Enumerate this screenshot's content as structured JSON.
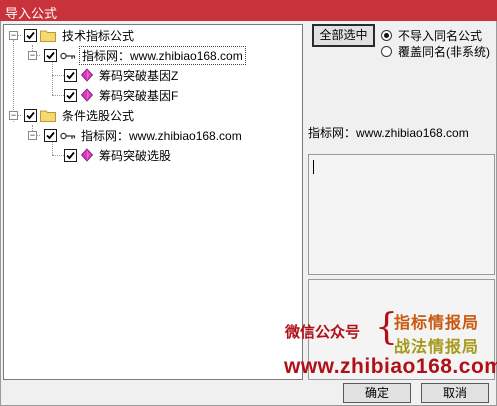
{
  "window": {
    "title": "导入公式"
  },
  "tree": {
    "group1": {
      "label": "技术指标公式",
      "source": "指标网：www.zhibiao168.com",
      "children": [
        "筹码突破基因Z",
        "筹码突破基因F"
      ]
    },
    "group2": {
      "label": "条件选股公式",
      "source": "指标网：www.zhibiao168.com",
      "children": [
        "筹码突破选股"
      ]
    }
  },
  "actions": {
    "select_all": "全部选中"
  },
  "options": {
    "skip_same_name": "不导入同名公式",
    "overwrite_same_name": "覆盖同名(非系统)",
    "selected": "skip_same_name"
  },
  "info": {
    "source_label": "指标网：www.zhibiao168.com"
  },
  "watermark": {
    "wechat": "微信公众号",
    "line1": "指标情报局",
    "line2": "战法情报局",
    "url": "www.zhibiao168.com"
  },
  "bottom_buttons": {
    "ok": "确定",
    "cancel": "取消"
  },
  "colors": {
    "title_bar": "#c8323b",
    "watermark_red": "#b01018",
    "watermark_orange": "#c85a10",
    "watermark_olive": "#a69a1a"
  }
}
